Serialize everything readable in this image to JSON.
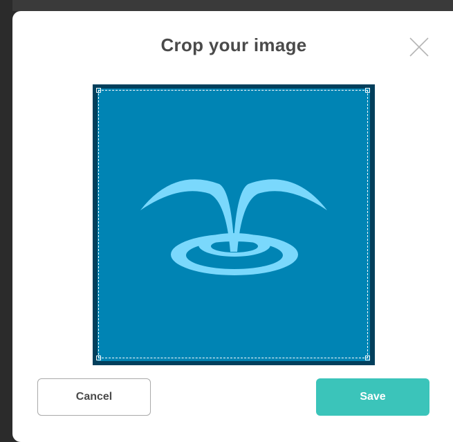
{
  "dialog": {
    "title": "Crop your image",
    "close_icon": "close-icon",
    "cancel_label": "Cancel",
    "save_label": "Save"
  },
  "crop": {
    "image_icon": "water-fountain-logo",
    "colors": {
      "outer": "#023f5c",
      "image_bg": "#0084b4",
      "logo": "#7ad8fc",
      "frame": "#ffffff"
    }
  },
  "colors": {
    "title": "#4a4a4a",
    "save_button": "#3bc4ba",
    "cancel_border": "#a9a9a9"
  }
}
